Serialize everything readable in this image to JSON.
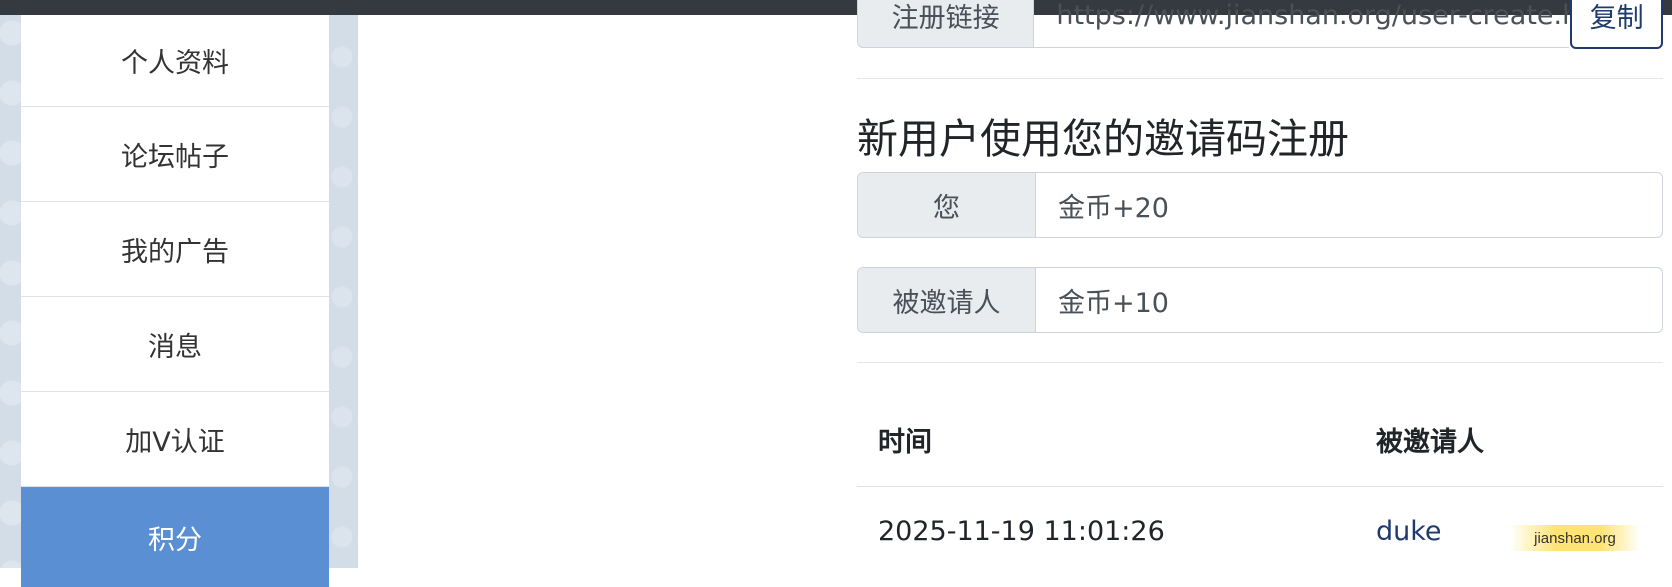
{
  "sidebar": {
    "items": [
      {
        "label": "个人资料",
        "active": false
      },
      {
        "label": "论坛帖子",
        "active": false
      },
      {
        "label": "我的广告",
        "active": false
      },
      {
        "label": "消息",
        "active": false
      },
      {
        "label": "加V认证",
        "active": false
      },
      {
        "label": "积分",
        "active": true
      }
    ]
  },
  "register_link": {
    "label": "注册链接",
    "value": "https://www.jianshan.org/user-create.h",
    "copy_label": "复制"
  },
  "invite_section": {
    "title": "新用户使用您的邀请码注册",
    "rewards": [
      {
        "label": "您",
        "value": "金币+20"
      },
      {
        "label": "被邀请人",
        "value": "金币+10"
      }
    ]
  },
  "table": {
    "headers": [
      "时间",
      "被邀请人"
    ],
    "rows": [
      {
        "time": "2025-11-19 11:01:26",
        "invitee": "duke"
      }
    ]
  },
  "watermark": "jianshan.org",
  "colors": {
    "active_sidebar": "#5b8fd3",
    "link": "#1f3b6e",
    "topbar": "#343a40"
  }
}
